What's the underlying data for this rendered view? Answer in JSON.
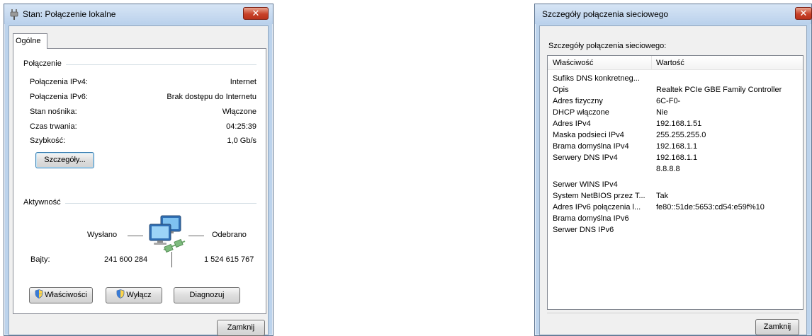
{
  "status_window": {
    "title": "Stan: Połączenie lokalne",
    "close_glyph": "✕",
    "tab_label": "Ogólne",
    "connection": {
      "section_title": "Połączenie",
      "rows": [
        {
          "label": "Połączenia IPv4:",
          "value": "Internet"
        },
        {
          "label": "Połączenia IPv6:",
          "value": "Brak dostępu do Internetu"
        },
        {
          "label": "Stan nośnika:",
          "value": "Włączone"
        },
        {
          "label": "Czas trwania:",
          "value": "04:25:39"
        },
        {
          "label": "Szybkość:",
          "value": "1,0 Gb/s"
        }
      ],
      "details_button": "Szczegóły..."
    },
    "activity": {
      "section_title": "Aktywność",
      "sent_label": "Wysłano",
      "received_label": "Odebrano",
      "bytes_label": "Bajty:",
      "bytes_sent": "241 600 284",
      "bytes_received": "1 524 615 767"
    },
    "buttons": {
      "properties": "Właściwości",
      "disable": "Wyłącz",
      "diagnose": "Diagnozuj",
      "close": "Zamknij"
    }
  },
  "details_window": {
    "title": "Szczegóły połączenia sieciowego",
    "close_glyph": "✕",
    "list_caption": "Szczegóły połączenia sieciowego:",
    "columns": [
      "Właściwość",
      "Wartość"
    ],
    "rows": [
      {
        "property": "Sufiks DNS konkretneg...",
        "value": ""
      },
      {
        "property": "Opis",
        "value": "Realtek PCIe GBE Family Controller"
      },
      {
        "property": "Adres fizyczny",
        "value": "6C-F0-"
      },
      {
        "property": "DHCP włączone",
        "value": "Nie"
      },
      {
        "property": "Adres IPv4",
        "value": "192.168.1.51"
      },
      {
        "property": "Maska podsieci IPv4",
        "value": "255.255.255.0"
      },
      {
        "property": "Brama domyślna IPv4",
        "value": "192.168.1.1"
      },
      {
        "property": "Serwery DNS IPv4",
        "value": "192.168.1.1"
      },
      {
        "property": "",
        "value": "8.8.8.8"
      },
      {
        "property": "Serwer WINS IPv4",
        "value": ""
      },
      {
        "property": "System NetBIOS przez T...",
        "value": "Tak"
      },
      {
        "property": "Adres IPv6 połączenia l...",
        "value": "fe80::51de:5653:cd54:e59f%10"
      },
      {
        "property": "Brama domyślna IPv6",
        "value": ""
      },
      {
        "property": "Serwer DNS IPv6",
        "value": ""
      }
    ],
    "close_button": "Zamknij"
  }
}
